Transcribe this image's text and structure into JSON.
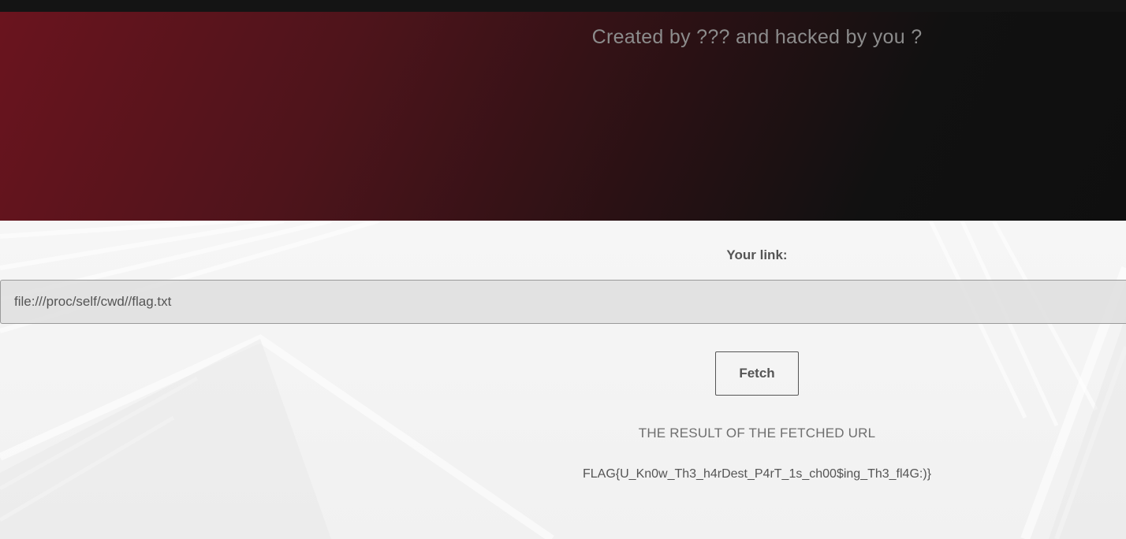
{
  "header": {
    "credit": "Created by ??? and hacked by you ?"
  },
  "form": {
    "label": "Your link:",
    "url_value": "file:///proc/self/cwd//flag.txt",
    "fetch_label": "Fetch"
  },
  "result": {
    "heading": "THE RESULT OF THE FETCHED URL",
    "value": "FLAG{U_Kn0w_Th3_h4rDest_P4rT_1s_ch00$ing_Th3_fl4G:)}"
  }
}
